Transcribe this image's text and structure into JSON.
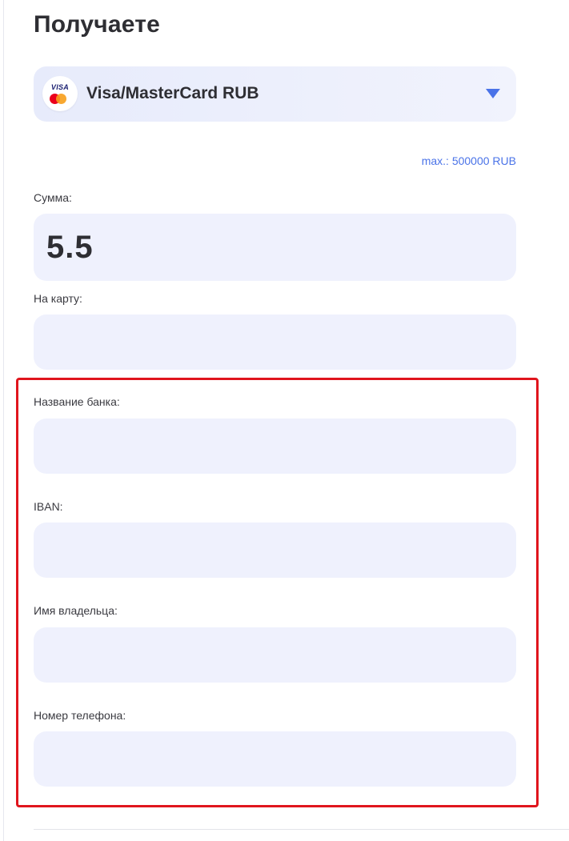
{
  "header": {
    "title": "Получаете"
  },
  "method_select": {
    "logo_text": "VISA",
    "selected": "Visa/MasterCard RUB",
    "chevron_icon": "chevron-down-icon",
    "accent_color": "#4a73e8"
  },
  "limits": {
    "max_note": "max.: 500000 RUB"
  },
  "form": {
    "amount": {
      "label": "Сумма:",
      "value": "5.5"
    },
    "card": {
      "label": "На карту:",
      "value": ""
    },
    "bank_name": {
      "label": "Название банка:",
      "value": ""
    },
    "iban": {
      "label": "IBAN:",
      "value": ""
    },
    "owner_name": {
      "label": "Имя владельца:",
      "value": ""
    },
    "phone": {
      "label": "Номер телефона:",
      "value": ""
    }
  },
  "highlight": {
    "color": "#e0151d"
  }
}
